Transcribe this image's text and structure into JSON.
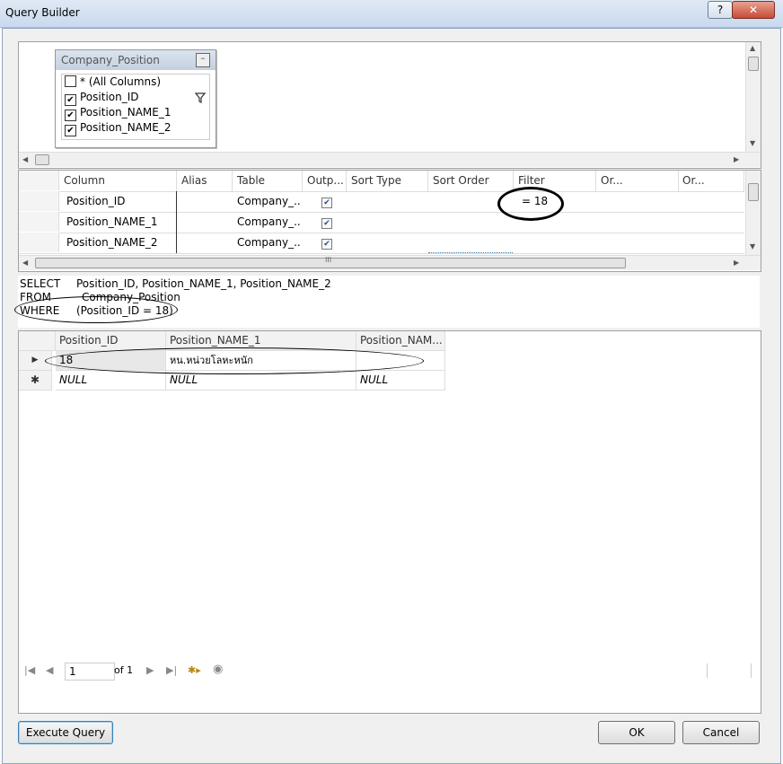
{
  "window": {
    "title": "Query Builder",
    "help_label": "?",
    "close_label": "✕"
  },
  "diagram": {
    "table_name": "Company_Position",
    "minimize_label": "–",
    "columns": [
      {
        "label": "* (All Columns)",
        "checked": false
      },
      {
        "label": "Position_ID",
        "checked": true,
        "has_filter": true
      },
      {
        "label": "Position_NAME_1",
        "checked": true
      },
      {
        "label": "Position_NAME_2",
        "checked": true
      }
    ]
  },
  "criteria_grid": {
    "headers": [
      "Column",
      "Alias",
      "Table",
      "Outp...",
      "Sort Type",
      "Sort Order",
      "Filter",
      "Or...",
      "Or..."
    ],
    "rows": [
      {
        "column": "Position_ID",
        "alias": "",
        "table": "Company_...",
        "output": true,
        "sort_type": "",
        "sort_order": "",
        "filter": "= 18"
      },
      {
        "column": "Position_NAME_1",
        "alias": "",
        "table": "Company_...",
        "output": true,
        "sort_type": "",
        "sort_order": "",
        "filter": ""
      },
      {
        "column": "Position_NAME_2",
        "alias": "",
        "table": "Company_...",
        "output": true,
        "sort_type": "",
        "sort_order": "",
        "filter": ""
      }
    ],
    "hscroll_grip": "III"
  },
  "sql": {
    "select_kw": "SELECT",
    "select_cols": "Position_ID, Position_NAME_1, Position_NAME_2",
    "from_kw": "FROM",
    "from_table": "Company_Position",
    "where_kw": "WHERE",
    "where_cond": "(Position_ID = 18)"
  },
  "results": {
    "headers": [
      "Position_ID",
      "Position_NAME_1",
      "Position_NAM..."
    ],
    "rows": [
      {
        "marker": "▶",
        "cells": [
          "18",
          "หน.หน่วยโลหะหนัก",
          ""
        ]
      },
      {
        "marker": "✱",
        "cells": [
          "NULL",
          "NULL",
          "NULL"
        ]
      }
    ]
  },
  "navigator": {
    "first": "|◀",
    "prev": "◀",
    "page": "1",
    "of_label": "of 1",
    "next": "▶",
    "last": "▶|",
    "new": "✱▸",
    "stop": "◉"
  },
  "buttons": {
    "execute": "Execute Query",
    "ok": "OK",
    "cancel": "Cancel"
  },
  "colors": {
    "annotation": "#000000",
    "accent": "#3c7fb1"
  }
}
